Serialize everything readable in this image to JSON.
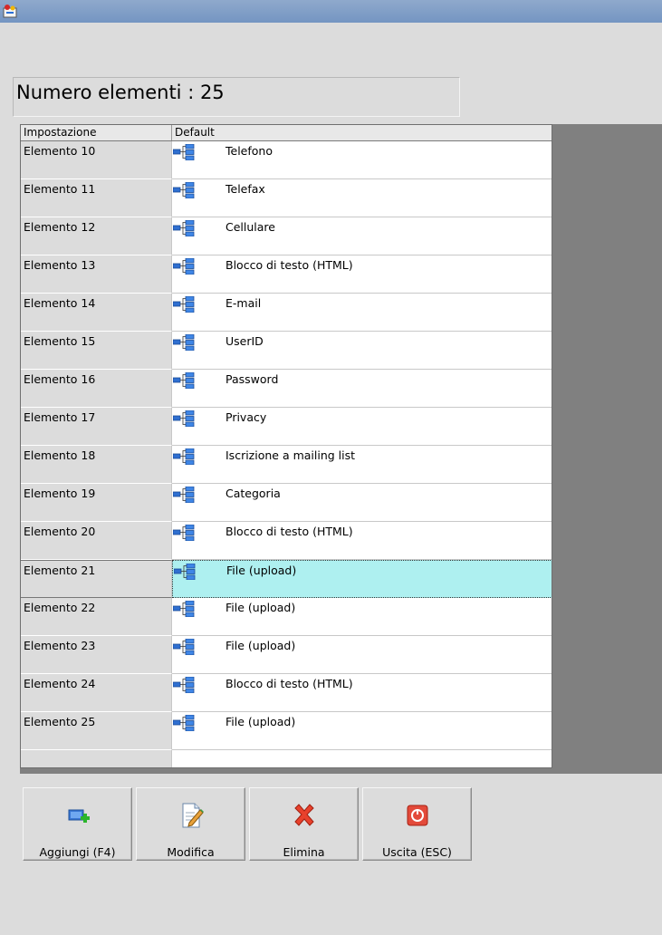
{
  "window": {
    "app_icon": "app-icon"
  },
  "count_label": "Numero elementi : 25",
  "grid": {
    "headers": {
      "setting": "Impostazione",
      "default": "Default"
    },
    "rows": [
      {
        "setting": "Elemento 10",
        "icon": "tree-structure-icon",
        "value": "Telefono"
      },
      {
        "setting": "Elemento 11",
        "icon": "tree-structure-icon",
        "value": "Telefax"
      },
      {
        "setting": "Elemento 12",
        "icon": "tree-structure-icon",
        "value": "Cellulare"
      },
      {
        "setting": "Elemento 13",
        "icon": "tree-structure-icon",
        "value": "Blocco di testo (HTML)"
      },
      {
        "setting": "Elemento 14",
        "icon": "tree-structure-icon",
        "value": "E-mail"
      },
      {
        "setting": "Elemento 15",
        "icon": "tree-structure-icon",
        "value": "UserID"
      },
      {
        "setting": "Elemento 16",
        "icon": "tree-structure-icon",
        "value": "Password"
      },
      {
        "setting": "Elemento 17",
        "icon": "tree-structure-icon",
        "value": "Privacy"
      },
      {
        "setting": "Elemento 18",
        "icon": "tree-structure-icon",
        "value": "Iscrizione a mailing list"
      },
      {
        "setting": "Elemento 19",
        "icon": "tree-structure-icon",
        "value": "Categoria"
      },
      {
        "setting": "Elemento 20",
        "icon": "tree-structure-icon",
        "value": "Blocco di testo (HTML)"
      },
      {
        "setting": "Elemento 21",
        "icon": "tree-structure-icon",
        "value": "File (upload)",
        "selected": true
      },
      {
        "setting": "Elemento 22",
        "icon": "tree-structure-icon",
        "value": "File (upload)"
      },
      {
        "setting": "Elemento 23",
        "icon": "tree-structure-icon",
        "value": "File (upload)"
      },
      {
        "setting": "Elemento 24",
        "icon": "tree-structure-icon",
        "value": "Blocco di testo (HTML)"
      },
      {
        "setting": "Elemento 25",
        "icon": "tree-structure-icon",
        "value": "File (upload)"
      }
    ]
  },
  "buttons": {
    "add": {
      "label": "Aggiungi (F4)",
      "icon": "add-icon"
    },
    "edit": {
      "label": "Modifica",
      "icon": "edit-icon"
    },
    "delete": {
      "label": "Elimina",
      "icon": "delete-icon"
    },
    "exit": {
      "label": "Uscita (ESC)",
      "icon": "exit-icon"
    }
  },
  "colors": {
    "selected_row": "#aef0f0",
    "titlebar": "#7f9cc6"
  }
}
